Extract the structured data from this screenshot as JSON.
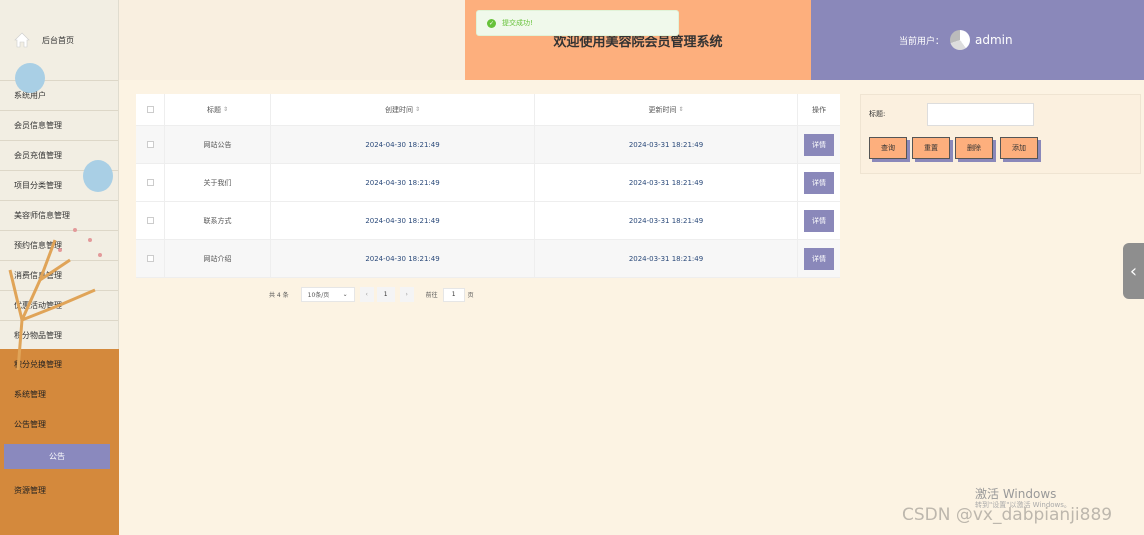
{
  "sidebar": {
    "home_label": "后台首页",
    "items": [
      "系统用户",
      "会员信息管理",
      "会员充值管理",
      "项目分类管理",
      "美容师信息管理",
      "预约信息管理",
      "消费信息管理",
      "优惠活动管理",
      "积分物品管理",
      "积分兑换管理",
      "系统管理",
      "公告管理"
    ],
    "sub_active": "公告",
    "last_item": "资源管理"
  },
  "header": {
    "title": "欢迎使用美容院会员管理系统",
    "user_label": "当前用户：",
    "username": "admin"
  },
  "toast": {
    "message": "提交成功!"
  },
  "table": {
    "headers": [
      "标题",
      "创建时间",
      "更新时间",
      "操作"
    ],
    "rows": [
      {
        "title": "网站公告",
        "created": "2024-04-30 18:21:49",
        "updated": "2024-03-31 18:21:49",
        "action": "详情"
      },
      {
        "title": "关于我们",
        "created": "2024-04-30 18:21:49",
        "updated": "2024-03-31 18:21:49",
        "action": "详情"
      },
      {
        "title": "联系方式",
        "created": "2024-04-30 18:21:49",
        "updated": "2024-03-31 18:21:49",
        "action": "详情"
      },
      {
        "title": "网站介绍",
        "created": "2024-04-30 18:21:49",
        "updated": "2024-03-31 18:21:49",
        "action": "详情"
      }
    ]
  },
  "pager": {
    "total": "共 4 条",
    "page_size": "10条/页",
    "current": "1",
    "goto_label": "前往",
    "goto_value": "1",
    "page_unit": "页"
  },
  "search": {
    "label": "标题:",
    "buttons": [
      "查询",
      "重置",
      "删除",
      "添加"
    ]
  },
  "watermark": {
    "line1": "激活 Windows",
    "line2": "转到\"设置\"以激活 Windows。",
    "csdn": "CSDN @vx_dabpianji889"
  },
  "colors": {
    "accent_purple": "#8a88ba",
    "accent_orange": "#fdaf7d",
    "sidebar_orange": "#d4893c",
    "background": "#fcf3e3"
  }
}
